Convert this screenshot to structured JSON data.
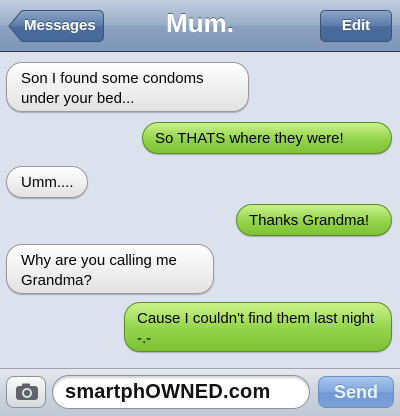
{
  "navbar": {
    "back_label": "Messages",
    "title": "Mum.",
    "edit_label": "Edit"
  },
  "messages": [
    {
      "from": "them",
      "text": "Son I found some condoms under your bed..."
    },
    {
      "from": "me",
      "text": "So THATS where they were!"
    },
    {
      "from": "them",
      "text": "Umm...."
    },
    {
      "from": "me",
      "text": "Thanks Grandma!"
    },
    {
      "from": "them",
      "text": "Why are you calling me Grandma?"
    },
    {
      "from": "me",
      "text": "Cause I couldn't find them last night -.-"
    }
  ],
  "composer": {
    "input_value": "smartphOWNED.com",
    "send_label": "Send",
    "camera_icon": "camera-icon"
  },
  "colors": {
    "nav_bar": "#8aa1bf",
    "thread_bg": "#dbe2ed",
    "incoming_bubble": "#eeeeee",
    "outgoing_bubble": "#92d34b",
    "send_button": "#7fa6dc"
  }
}
